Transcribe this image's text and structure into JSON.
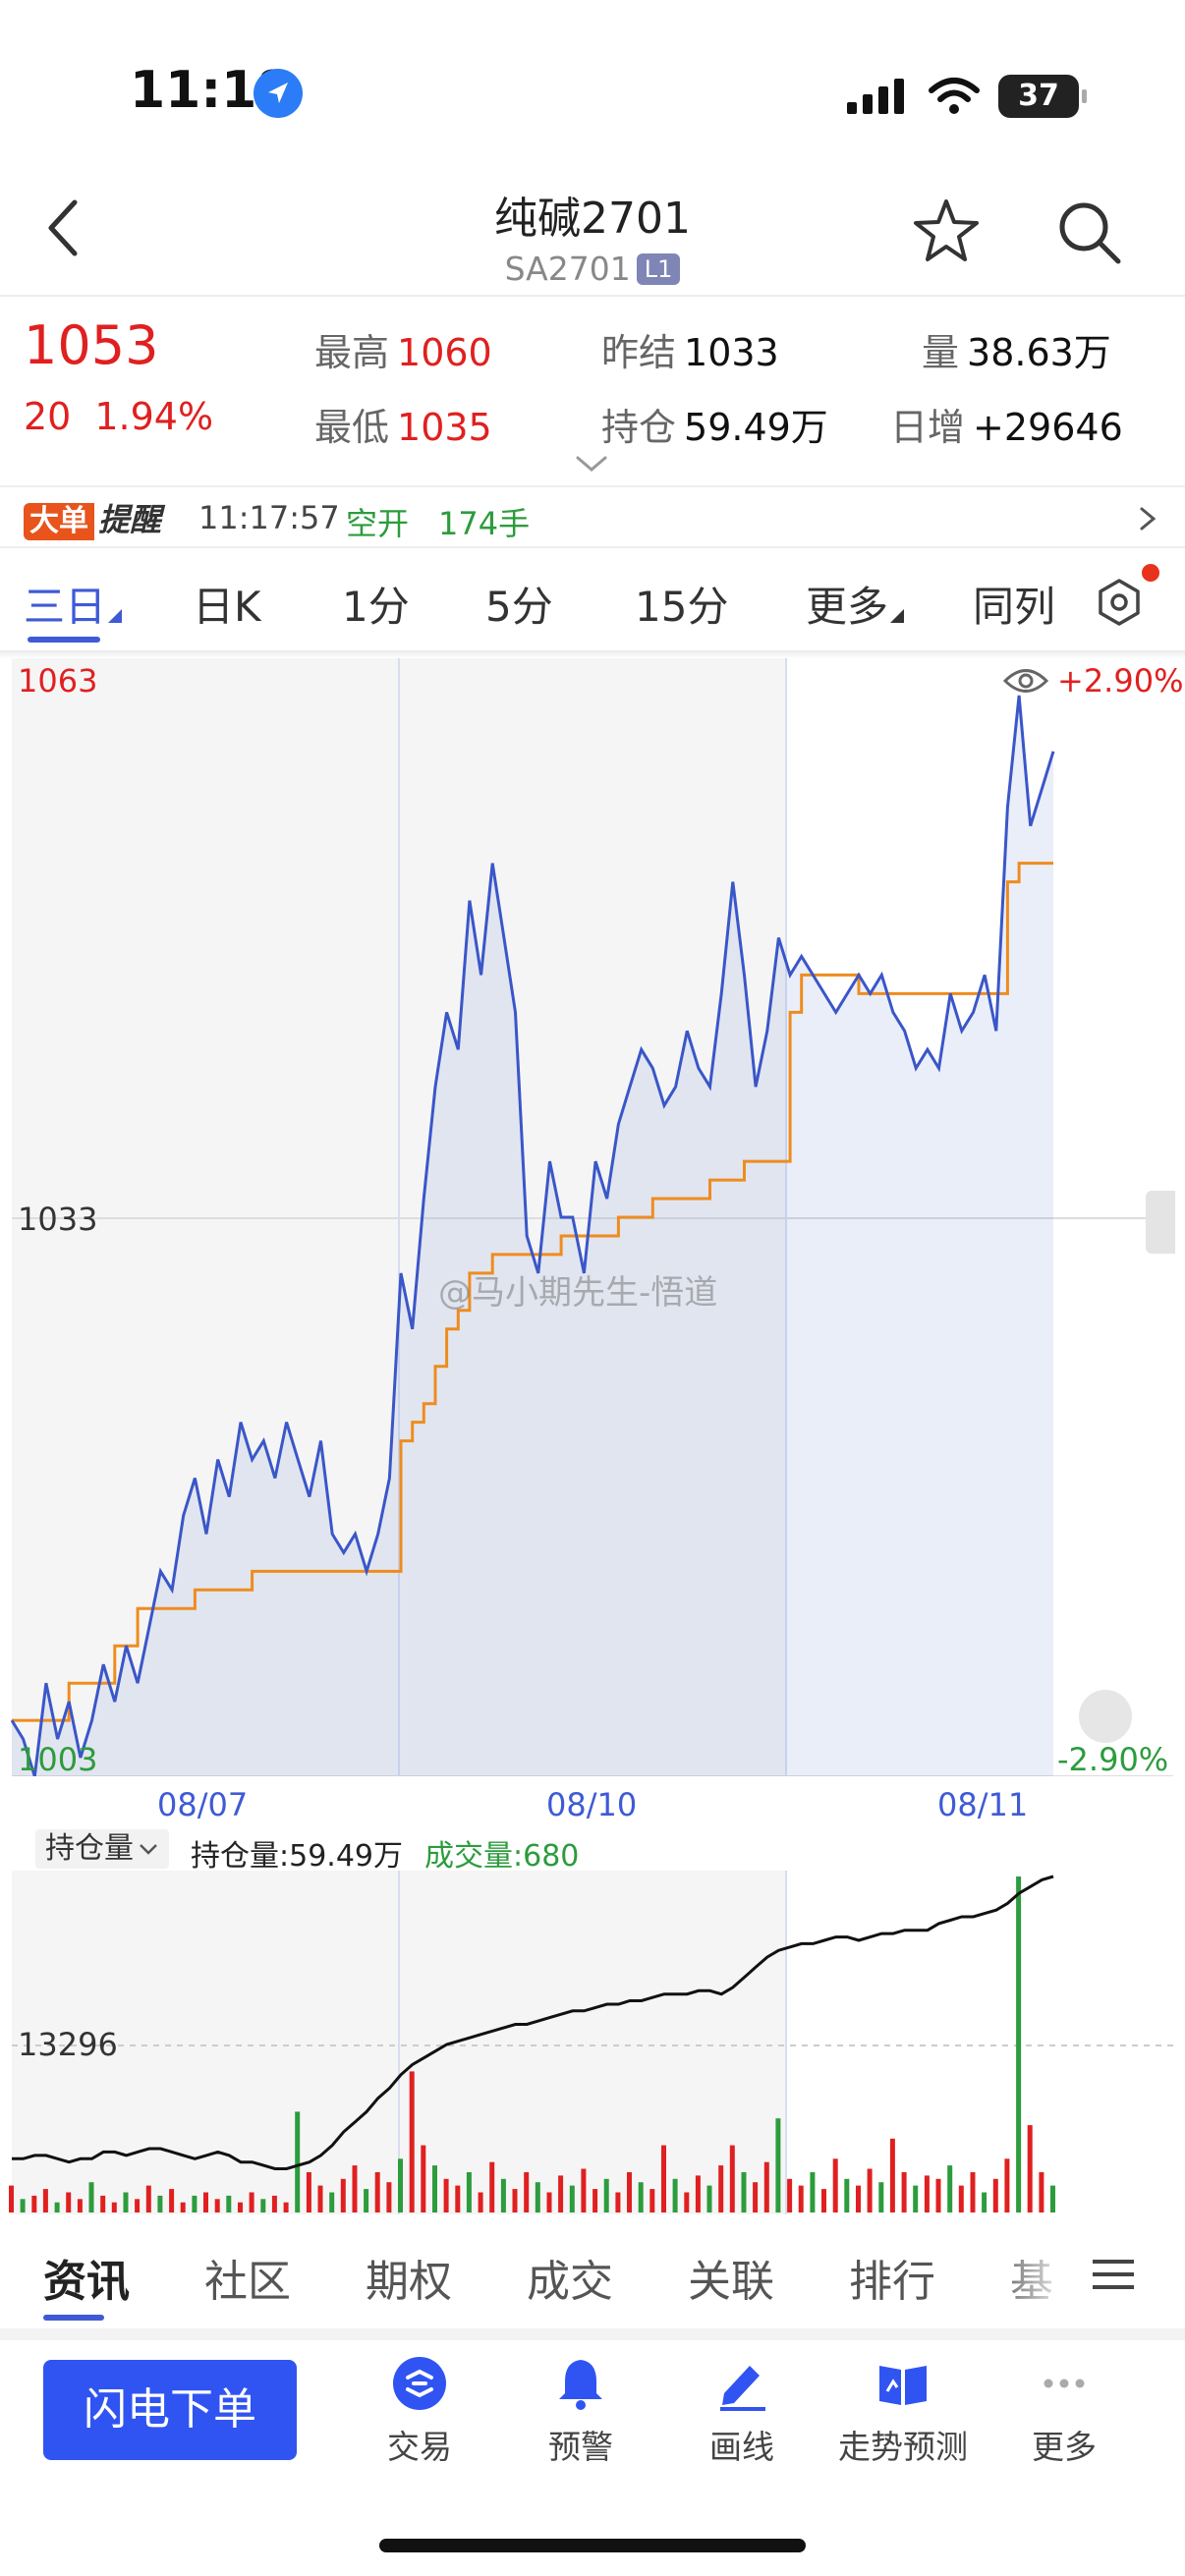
{
  "status": {
    "time": "11:18",
    "battery": "37",
    "icons": [
      "location-arrow-icon",
      "cellular-signal-icon",
      "wifi-icon",
      "battery-icon"
    ]
  },
  "header": {
    "title": "纯碱2701",
    "code": "SA2701",
    "level_badge": "L1",
    "icons": [
      "back-arrow-icon",
      "star-icon",
      "search-icon"
    ]
  },
  "quote": {
    "price": "1053",
    "change": "20",
    "change_pct": "1.94%",
    "high_label": "最高",
    "high": "1060",
    "low_label": "最低",
    "low": "1035",
    "prev_settle_label": "昨结",
    "prev_settle": "1033",
    "open_interest_label": "持仓",
    "open_interest": "59.49万",
    "volume_label": "量",
    "volume": "38.63万",
    "daily_increase_label": "日增",
    "daily_increase": "+29646"
  },
  "reminder": {
    "logo_part1": "大单",
    "logo_part2": "提醒",
    "time": "11:17:57",
    "type": "空开",
    "qty": "174手"
  },
  "period_tabs": [
    {
      "label": "三日",
      "active": true
    },
    {
      "label": "日K"
    },
    {
      "label": "1分"
    },
    {
      "label": "5分"
    },
    {
      "label": "15分"
    },
    {
      "label": "更多"
    },
    {
      "label": "同列"
    }
  ],
  "main_chart": {
    "y_top": "1063",
    "y_mid": "1033",
    "y_bottom": "1003",
    "pct_top": "+2.90%",
    "pct_bottom": "-2.90%",
    "dates": [
      "08/07",
      "08/10",
      "08/11"
    ],
    "watermark": "@马小期先生-悟道"
  },
  "indicator": {
    "select_label": "持仓量",
    "oi_label": "持仓量:59.49万",
    "vol_label": "成交量:680",
    "y_label": "13296"
  },
  "bottom_tabs": [
    {
      "label": "资讯",
      "active": true
    },
    {
      "label": "社区"
    },
    {
      "label": "期权"
    },
    {
      "label": "成交"
    },
    {
      "label": "关联"
    },
    {
      "label": "排行"
    },
    {
      "label": "基"
    }
  ],
  "actions": {
    "flash_order": "闪电下单",
    "items": [
      "交易",
      "预警",
      "画线",
      "走势预测",
      "更多"
    ]
  },
  "colors": {
    "accent": "#3f5ad6",
    "up": "#e02020",
    "down": "#2c9c3c",
    "price_line": "#3a56c8",
    "avg_line": "#ee8c1e"
  },
  "chart_data": [
    {
      "type": "line",
      "ylim": [
        1003,
        1063
      ],
      "y_ticks": [
        "1063",
        "1033",
        "1003"
      ],
      "categories": [
        "08/07",
        "08/10",
        "08/11"
      ],
      "series": [
        {
          "values": [
            1006,
            1005,
            1003,
            1008,
            1005,
            1007,
            1004,
            1006,
            1009,
            1007,
            1010,
            1008,
            1011,
            1014,
            1013,
            1017,
            1019,
            1016,
            1020,
            1018,
            1022,
            1020,
            1021,
            1019,
            1022,
            1020,
            1018,
            1021,
            1016,
            1015,
            1016,
            1014,
            1016,
            1019,
            1030,
            1027,
            1034,
            1040,
            1044,
            1042,
            1050,
            1046,
            1052,
            1048,
            1044,
            1032,
            1030,
            1036,
            1033,
            1033,
            1030,
            1036,
            1034,
            1038,
            1040,
            1042,
            1041,
            1039,
            1040,
            1043,
            1041,
            1040,
            1045,
            1051,
            1046,
            1040,
            1043,
            1048,
            1046,
            1047,
            1046,
            1045,
            1044,
            1045,
            1046,
            1045,
            1046,
            1044,
            1043,
            1041,
            1042,
            1041,
            1045,
            1043,
            1044,
            1046,
            1043,
            1055,
            1061,
            1054,
            1056,
            1058
          ],
          "color": "#3a56c8"
        },
        {
          "values": [
            1006,
            1006,
            1006,
            1006,
            1006,
            1008,
            1008,
            1008,
            1008,
            1010,
            1010,
            1012,
            1012,
            1012,
            1012,
            1012,
            1013,
            1013,
            1013,
            1013,
            1013,
            1014,
            1014,
            1014,
            1014,
            1014,
            1014,
            1014,
            1014,
            1014,
            1014,
            1014,
            1014,
            1014,
            1021,
            1022,
            1023,
            1025,
            1027,
            1028,
            1030,
            1030,
            1031,
            1031,
            1031,
            1031,
            1031,
            1031,
            1032,
            1032,
            1032,
            1032,
            1032,
            1033,
            1033,
            1033,
            1034,
            1034,
            1034,
            1034,
            1034,
            1035,
            1035,
            1035,
            1036,
            1036,
            1036,
            1036,
            1044,
            1046,
            1046,
            1046,
            1046,
            1046,
            1045,
            1045,
            1045,
            1045,
            1045,
            1045,
            1045,
            1045,
            1045,
            1045,
            1045,
            1045,
            1045,
            1051,
            1052,
            1052,
            1052,
            1052
          ],
          "color": "#ee8c1e"
        }
      ]
    },
    {
      "type": "line",
      "categories": [
        "08/07",
        "08/10",
        "08/11"
      ],
      "series": [
        {
          "values": [
            0.16,
            0.16,
            0.17,
            0.17,
            0.16,
            0.15,
            0.16,
            0.16,
            0.18,
            0.18,
            0.17,
            0.18,
            0.19,
            0.19,
            0.18,
            0.17,
            0.16,
            0.17,
            0.18,
            0.17,
            0.15,
            0.15,
            0.14,
            0.13,
            0.13,
            0.14,
            0.15,
            0.17,
            0.2,
            0.24,
            0.27,
            0.3,
            0.34,
            0.37,
            0.41,
            0.44,
            0.46,
            0.48,
            0.5,
            0.51,
            0.52,
            0.53,
            0.54,
            0.55,
            0.56,
            0.56,
            0.57,
            0.58,
            0.59,
            0.6,
            0.6,
            0.61,
            0.62,
            0.62,
            0.63,
            0.63,
            0.64,
            0.65,
            0.65,
            0.65,
            0.66,
            0.66,
            0.65,
            0.67,
            0.7,
            0.73,
            0.76,
            0.78,
            0.79,
            0.8,
            0.8,
            0.81,
            0.82,
            0.82,
            0.81,
            0.82,
            0.83,
            0.83,
            0.84,
            0.84,
            0.84,
            0.86,
            0.87,
            0.88,
            0.88,
            0.89,
            0.9,
            0.92,
            0.95,
            0.97,
            0.99,
            1.0
          ],
          "color": "#111111"
        },
        {
          "values": [
            0.08,
            0.04,
            0.05,
            0.07,
            0.03,
            0.06,
            0.04,
            0.09,
            0.05,
            0.03,
            0.06,
            0.04,
            0.08,
            0.05,
            0.07,
            0.03,
            0.05,
            0.06,
            0.04,
            0.05,
            0.03,
            0.06,
            0.04,
            0.05,
            0.03,
            0.3,
            0.12,
            0.08,
            0.06,
            0.1,
            0.14,
            0.07,
            0.12,
            0.09,
            0.16,
            0.42,
            0.2,
            0.14,
            0.1,
            0.08,
            0.12,
            0.06,
            0.15,
            0.1,
            0.07,
            0.12,
            0.09,
            0.06,
            0.11,
            0.08,
            0.13,
            0.07,
            0.1,
            0.06,
            0.12,
            0.09,
            0.07,
            0.2,
            0.1,
            0.06,
            0.11,
            0.08,
            0.14,
            0.2,
            0.12,
            0.09,
            0.15,
            0.28,
            0.1,
            0.08,
            0.12,
            0.07,
            0.16,
            0.1,
            0.08,
            0.13,
            0.09,
            0.22,
            0.12,
            0.08,
            0.11,
            0.1,
            0.14,
            0.08,
            0.12,
            0.06,
            0.1,
            0.16,
            1.0,
            0.26,
            0.12,
            0.08
          ],
          "color": "#e02020"
        }
      ]
    }
  ]
}
